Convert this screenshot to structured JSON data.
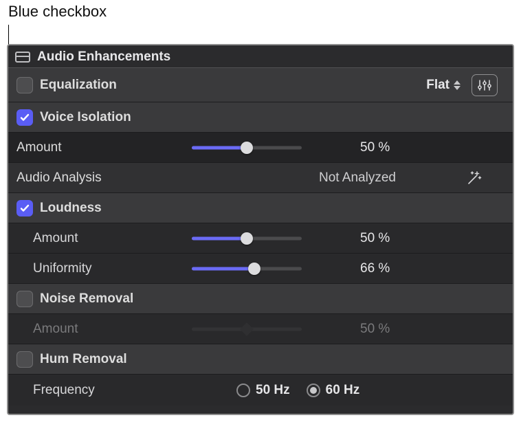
{
  "callout": "Blue checkbox",
  "panel_title": "Audio Enhancements",
  "equalization": {
    "label": "Equalization",
    "checked": false,
    "preset": "Flat"
  },
  "voice_isolation": {
    "label": "Voice Isolation",
    "checked": true,
    "amount_label": "Amount",
    "amount_value": "50 %",
    "amount_pct": 50,
    "analysis_label": "Audio Analysis",
    "analysis_status": "Not Analyzed"
  },
  "loudness": {
    "label": "Loudness",
    "checked": true,
    "amount_label": "Amount",
    "amount_value": "50 %",
    "amount_pct": 50,
    "uniformity_label": "Uniformity",
    "uniformity_value": "66 %",
    "uniformity_pct": 66
  },
  "noise_removal": {
    "label": "Noise Removal",
    "checked": false,
    "amount_label": "Amount",
    "amount_value": "50 %",
    "amount_pct": 50
  },
  "hum_removal": {
    "label": "Hum Removal",
    "checked": false,
    "frequency_label": "Frequency",
    "options": {
      "opt50": "50 Hz",
      "opt60": "60 Hz"
    },
    "selected": "60"
  }
}
